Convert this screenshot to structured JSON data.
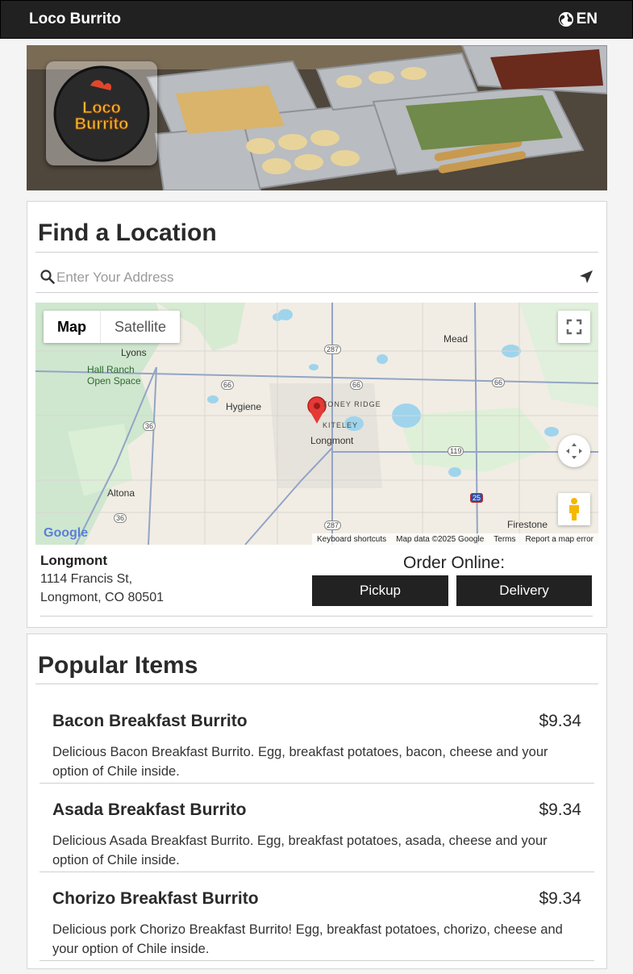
{
  "header": {
    "brand": "Loco Burrito",
    "language": "EN",
    "language_icon": "globe-icon"
  },
  "hero": {
    "logo_text_top": "Loco",
    "logo_text_bottom": "Burrito"
  },
  "locator": {
    "title": "Find a Location",
    "search": {
      "placeholder": "Enter Your Address",
      "value": ""
    },
    "map": {
      "type_tabs": [
        "Map",
        "Satellite"
      ],
      "active_tab": "Map",
      "places": [
        "Mead",
        "Lyons",
        "Hall Ranch Open Space",
        "Hygiene",
        "TONEY RIDGE",
        "KITELEY",
        "Longmont",
        "Altona",
        "Firestone"
      ],
      "route_shields": [
        "287",
        "66",
        "66",
        "66",
        "36",
        "119",
        "36",
        "287",
        "25"
      ],
      "google": "Google",
      "attribution": [
        "Keyboard shortcuts",
        "Map data ©2025 Google",
        "Terms",
        "Report a map error"
      ]
    },
    "location": {
      "name": "Longmont",
      "address_line1": "1114 Francis St,",
      "address_line2": "Longmont, CO 80501"
    },
    "order": {
      "label": "Order Online:",
      "pickup": "Pickup",
      "delivery": "Delivery"
    }
  },
  "popular": {
    "title": "Popular Items",
    "items": [
      {
        "name": "Bacon Breakfast Burrito",
        "price": "$9.34",
        "description": "Delicious Bacon Breakfast Burrito. Egg, breakfast potatoes, bacon, cheese and your option of Chile inside."
      },
      {
        "name": "Asada Breakfast Burrito",
        "price": "$9.34",
        "description": "Delicious Asada Breakfast Burrito. Egg, breakfast potatoes, asada, cheese and your option of Chile inside."
      },
      {
        "name": "Chorizo Breakfast Burrito",
        "price": "$9.34",
        "description": "Delicious pork Chorizo Breakfast Burrito! Egg, breakfast potatoes, chorizo, cheese and your option of Chile inside."
      }
    ]
  },
  "colors": {
    "header_bg": "#212121",
    "button_bg": "#222222",
    "marker": "#e53935"
  }
}
